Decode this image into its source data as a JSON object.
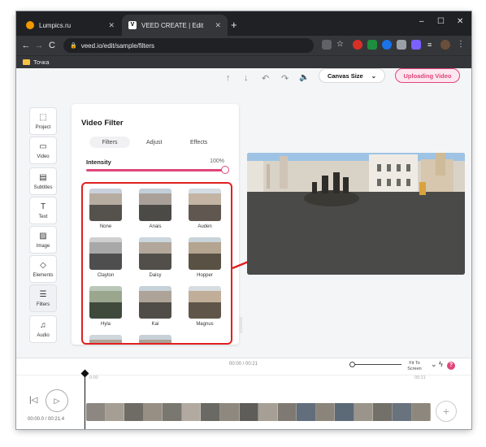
{
  "browser": {
    "tabs": [
      {
        "title": "Lumpics.ru",
        "active": false,
        "favicon_color": "#f29900"
      },
      {
        "title": "VEED CREATE | Edit",
        "active": true,
        "favicon_color": "#ffffff"
      }
    ],
    "new_tab_label": "+",
    "window_controls": {
      "minimize": "–",
      "maximize": "☐",
      "close": "✕"
    },
    "url": "veed.io/edit/sample/filters",
    "bookmark": "Точка",
    "nav": {
      "back": "←",
      "forward": "→",
      "reload": "C"
    }
  },
  "app": {
    "header": {
      "canvas_size_label": "Canvas Size",
      "upload_label": "Uploading Video",
      "accent": "#e0457b"
    },
    "sidebar": {
      "items": [
        {
          "label": "Project",
          "icon": "frame-icon"
        },
        {
          "label": "Video",
          "icon": "video-camera-icon"
        },
        {
          "label": "Subtitles",
          "icon": "subtitles-icon"
        },
        {
          "label": "Text",
          "icon": "text-icon"
        },
        {
          "label": "Image",
          "icon": "image-icon"
        },
        {
          "label": "Elements",
          "icon": "elements-icon"
        },
        {
          "label": "Filters",
          "icon": "filters-icon"
        },
        {
          "label": "Audio",
          "icon": "audio-icon"
        }
      ]
    },
    "panel": {
      "title": "Video Filter",
      "tabs": [
        "Filters",
        "Adjust",
        "Effects"
      ],
      "intensity_label": "Intensity",
      "intensity_value": "100%",
      "filters": [
        "None",
        "Anais",
        "Auden",
        "Clayton",
        "Daisy",
        "Hopper",
        "Hyla",
        "Kai",
        "Magnus"
      ]
    },
    "timeline": {
      "current_time": "00:00",
      "total_time": "00:21",
      "center_time": "00:00 / 00:21",
      "fit_label": "Fit To Screen",
      "playhead_time": "0:00",
      "end_time": "00:21",
      "player_time": "00:00.0 / 00:21.4",
      "help_badge": "?"
    }
  }
}
